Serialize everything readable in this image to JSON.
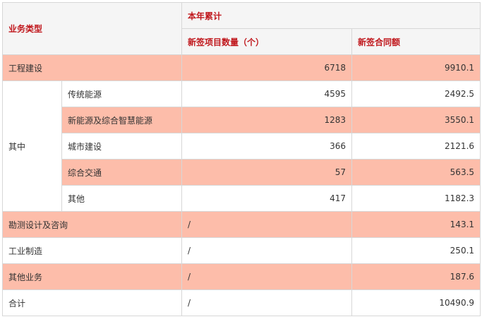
{
  "header": {
    "business_type": "业务类型",
    "ytd": "本年累计",
    "new_projects": "新签项目数量（个）",
    "new_contract_amount": "新签合同额"
  },
  "rows": [
    {
      "label": "工程建设",
      "count": "6718",
      "amount": "9910.1",
      "highlight": true
    },
    {
      "group": "其中",
      "label": "传统能源",
      "count": "4595",
      "amount": "2492.5",
      "highlight": false
    },
    {
      "label": "新能源及综合智慧能源",
      "count": "1283",
      "amount": "3550.1",
      "highlight": true
    },
    {
      "label": "城市建设",
      "count": "366",
      "amount": "2121.6",
      "highlight": false
    },
    {
      "label": "综合交通",
      "count": "57",
      "amount": "563.5",
      "highlight": true
    },
    {
      "label": "其他",
      "count": "417",
      "amount": "1182.3",
      "highlight": false
    },
    {
      "label": "勘测设计及咨询",
      "count": "/",
      "amount": "143.1",
      "highlight": true
    },
    {
      "label": "工业制造",
      "count": "/",
      "amount": "250.1",
      "highlight": false
    },
    {
      "label": "其他业务",
      "count": "/",
      "amount": "187.6",
      "highlight": true
    },
    {
      "label": "合计",
      "count": "/",
      "amount": "10490.9",
      "highlight": false
    }
  ],
  "colors": {
    "highlight_row": "#fdbdaa",
    "header_text": "#c0171c",
    "header_bg": "#f5f5f5",
    "border": "#d7d7d7"
  }
}
